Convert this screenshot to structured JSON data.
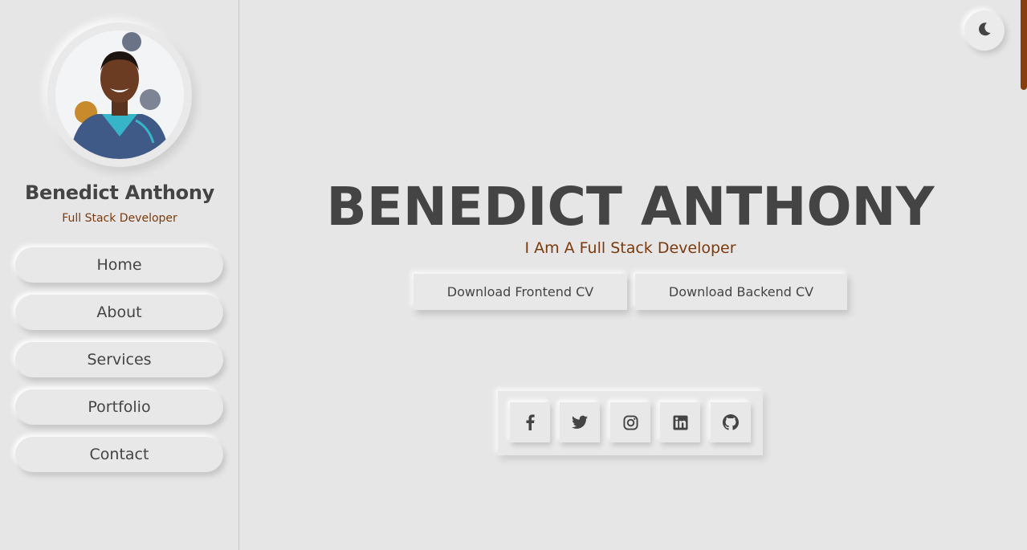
{
  "profile": {
    "name": "Benedict Anthony",
    "role": "Full Stack Developer"
  },
  "nav": {
    "items": [
      {
        "label": "Home"
      },
      {
        "label": "About"
      },
      {
        "label": "Services"
      },
      {
        "label": "Portfolio"
      },
      {
        "label": "Contact"
      }
    ]
  },
  "hero": {
    "title": "BENEDICT ANTHONY",
    "subtitle": "I Am A Full Stack Developer",
    "buttons": {
      "frontend_cv": "Download Frontend CV",
      "backend_cv": "Download Backend CV"
    }
  },
  "social": {
    "icons": [
      "facebook-icon",
      "twitter-icon",
      "instagram-icon",
      "linkedin-icon",
      "github-icon"
    ]
  },
  "theme": {
    "toggle_icon": "moon-icon"
  },
  "colors": {
    "background": "#e6e6e6",
    "text": "#444444",
    "accent": "#7a3a0c",
    "scroll_accent": "#8b3d0e"
  }
}
